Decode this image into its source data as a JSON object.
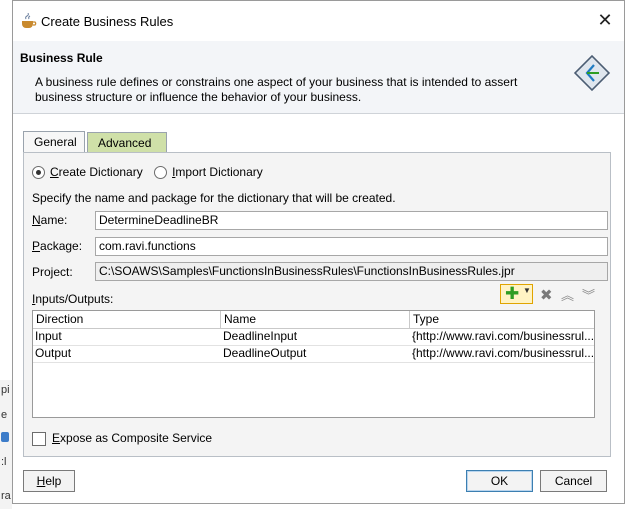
{
  "background": {
    "fragments": [
      "pi",
      "e",
      "",
      ":l",
      "ra"
    ]
  },
  "dialog": {
    "title": "Create Business Rules",
    "close_symbol": "✕",
    "title_icon": "java-cup-icon"
  },
  "header": {
    "title": "Business Rule",
    "description": "A business rule defines or constrains one aspect of your business that is intended to assert business structure or influence the behavior of your business.",
    "icon": "business-rule-icon"
  },
  "tabs": [
    {
      "label": "General",
      "active": true
    },
    {
      "label": "Advanced",
      "active": false
    }
  ],
  "general": {
    "radio_create_first": "C",
    "radio_create_rest": "reate Dictionary",
    "radio_import_first": "I",
    "radio_import_rest": "mport Dictionary",
    "selected": "create",
    "spec_text": "Specify the name and package for the dictionary that will be created.",
    "name_label_first": "N",
    "name_label_rest": "ame:",
    "name_value": "DetermineDeadlineBR",
    "package_label_first": "P",
    "package_label_rest": "ackage:",
    "package_value": "com.ravi.functions",
    "project_label": "Project:",
    "project_value": "C:\\SOAWS\\Samples\\FunctionsInBusinessRules\\FunctionsInBusinessRules.jpr",
    "io_label_first": "I",
    "io_label_rest": "nputs/Outputs:",
    "table": {
      "headers": [
        "Direction",
        "Name",
        "Type"
      ],
      "rows": [
        [
          "Input",
          "DeadlineInput",
          "{http://www.ravi.com/businessrul..."
        ],
        [
          "Output",
          "DeadlineOutput",
          "{http://www.ravi.com/businessrul..."
        ]
      ]
    },
    "expose_label_first": "E",
    "expose_label_rest": "xpose as Composite Service",
    "expose_checked": false
  },
  "buttons": {
    "help_first": "H",
    "help_rest": "elp",
    "ok": "OK",
    "cancel": "Cancel"
  },
  "colors": {
    "accent_green": "#2e9d22",
    "advanced_tab": "#cfe0a8",
    "add_button": "#fff3c4"
  }
}
